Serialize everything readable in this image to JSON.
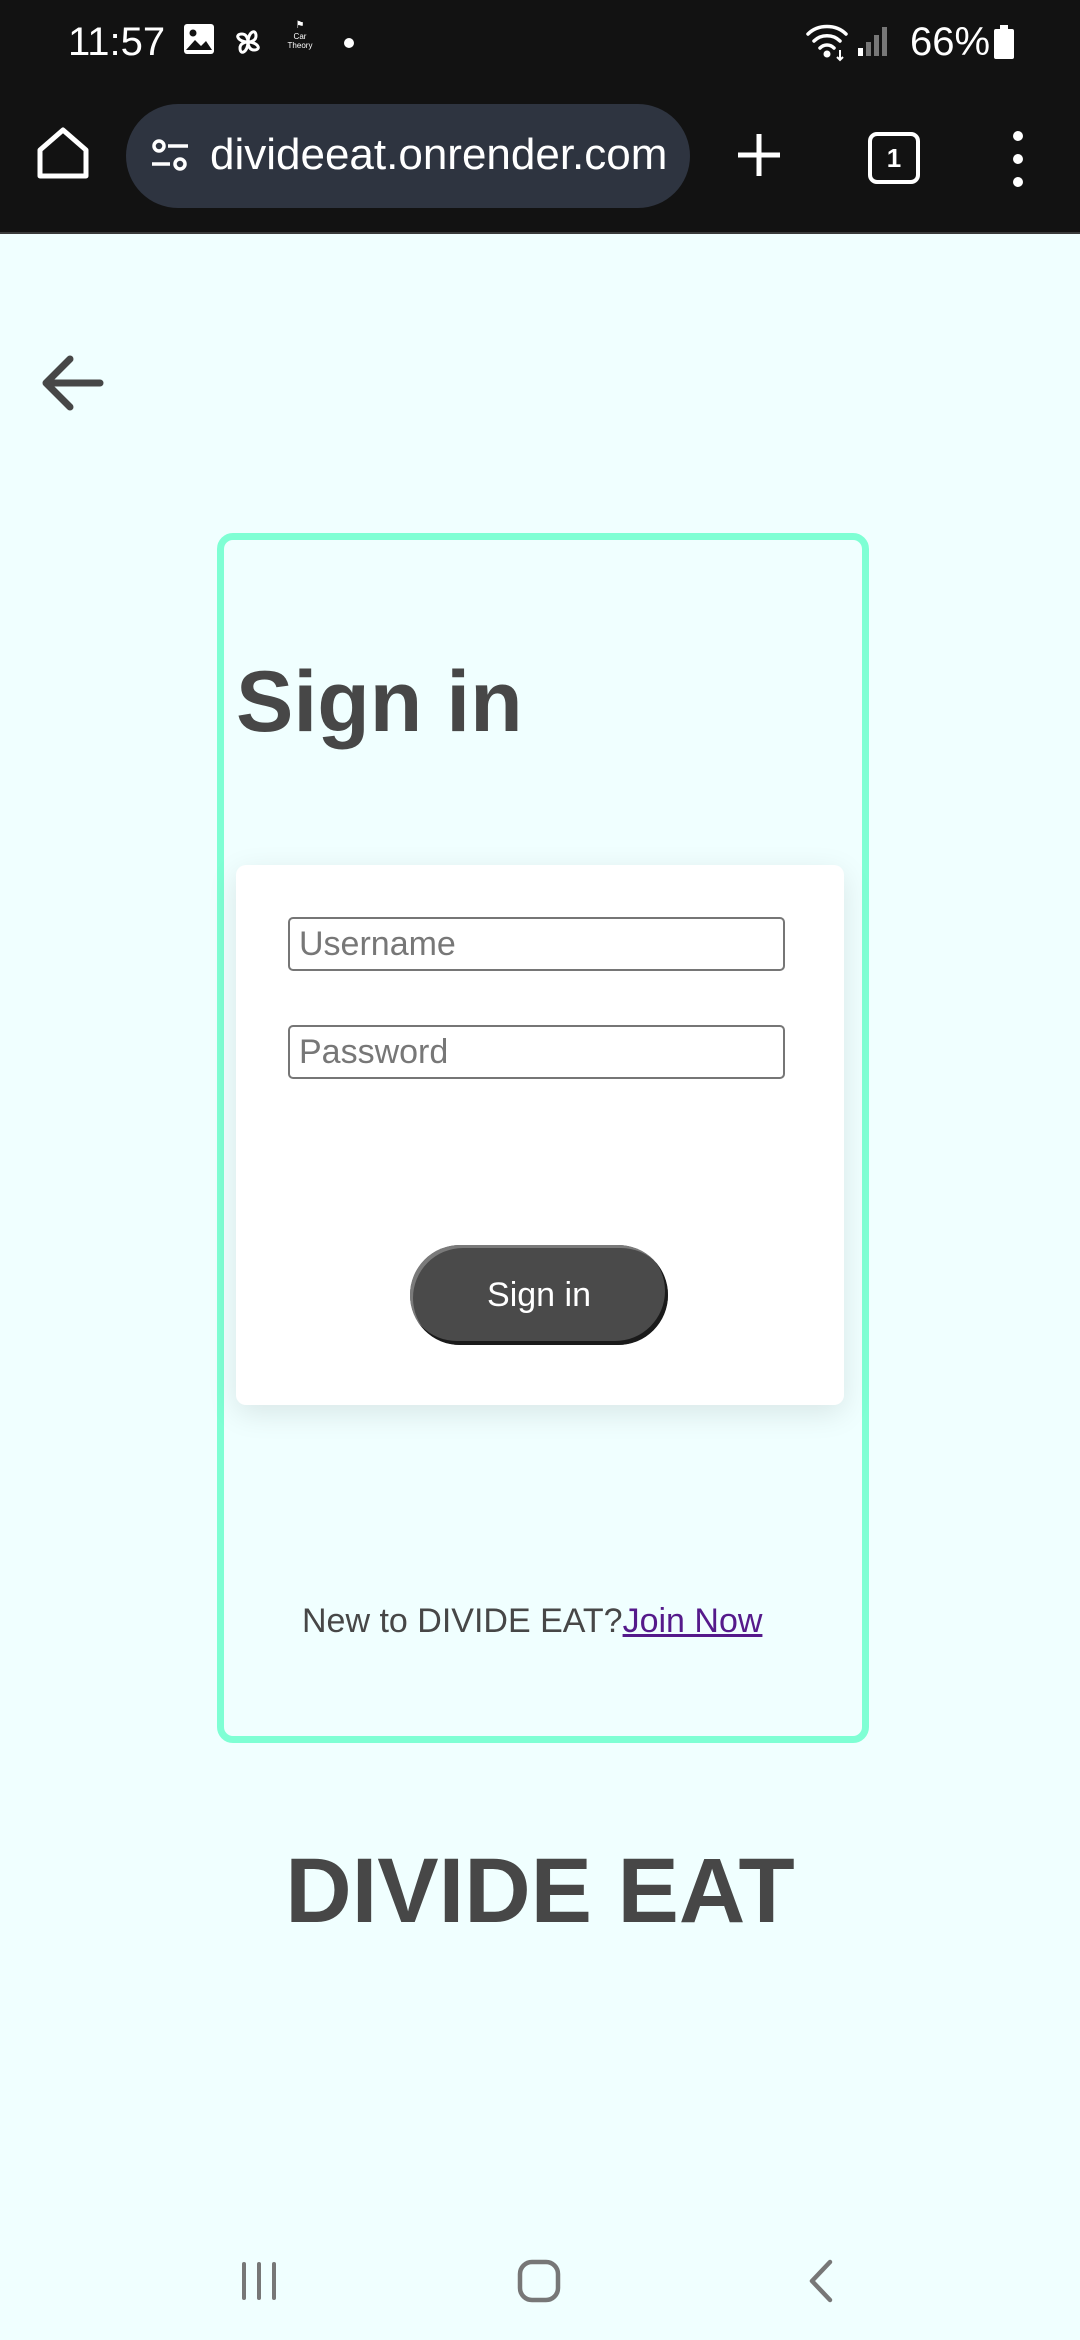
{
  "status_bar": {
    "time": "11:57",
    "notification_app_label": "Car Theory",
    "battery": "66%",
    "icons": [
      "gallery-icon",
      "pinwheel-icon",
      "car-theory-icon",
      "dot-icon",
      "wifi-icon",
      "signal-icon",
      "battery-icon"
    ]
  },
  "browser": {
    "url": "divideeat.onrender.com",
    "tab_count": "1",
    "icons": [
      "home-icon",
      "site-settings-icon",
      "plus-icon",
      "tabs-icon",
      "more-vert-icon"
    ]
  },
  "page": {
    "title": "Sign in",
    "username_placeholder": "Username",
    "password_placeholder": "Password",
    "submit_label": "Sign in",
    "signup_prompt": "New to DIVIDE EAT?",
    "signup_link": "Join Now",
    "brand": "DIVIDE EAT"
  },
  "colors": {
    "page_background": "#f0ffff",
    "frame_border": "#7fffd4",
    "text_dark": "#474747",
    "button_background": "#4a4a4a",
    "link": "#551a8b",
    "status_bar_background": "#121212",
    "url_bar_background": "#2e3440"
  }
}
